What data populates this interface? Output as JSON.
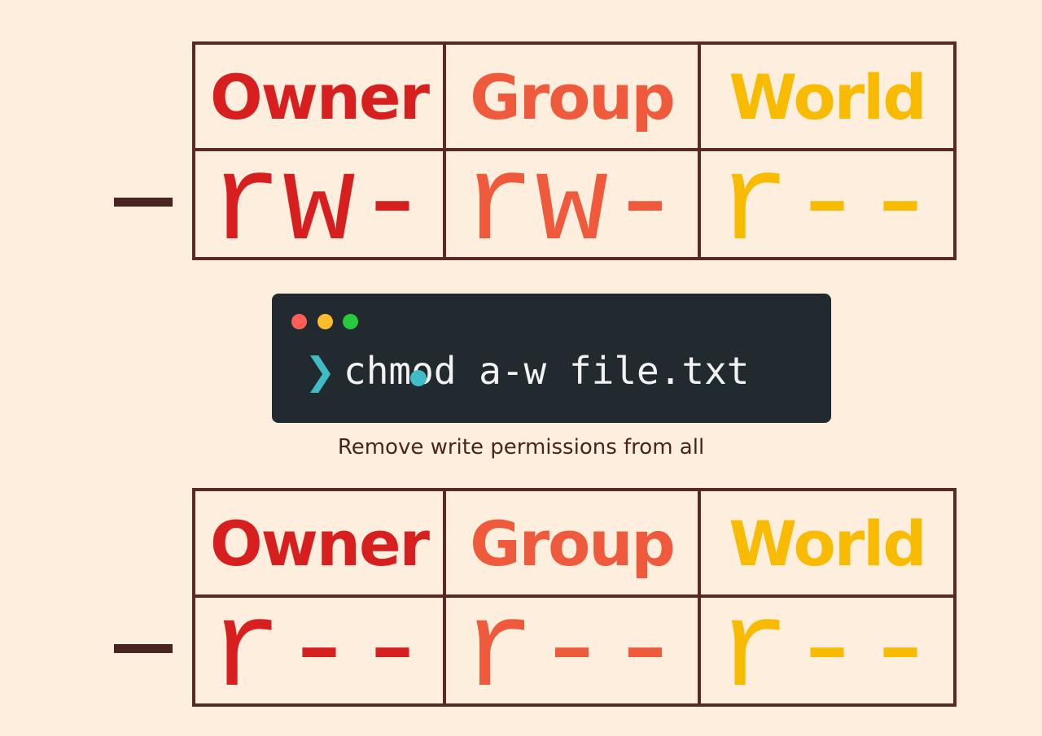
{
  "top_table": {
    "file_type": "-",
    "headers": [
      "Owner",
      "Group",
      "World"
    ],
    "permissions": [
      "rw-",
      "rw-",
      "r--"
    ]
  },
  "terminal": {
    "prompt_icon": "chevron-right-icon",
    "command": "chmod a-w file.txt"
  },
  "caption": "Remove write permissions from all",
  "bottom_table": {
    "file_type": "-",
    "headers": [
      "Owner",
      "Group",
      "World"
    ],
    "permissions": [
      "r--",
      "r--",
      "r--"
    ]
  },
  "colors": {
    "background": "#fdeedd",
    "border": "#5a2a22",
    "owner": "#d81f1f",
    "group": "#ef5a3c",
    "world": "#f8bb00",
    "terminal_bg": "#212a2e"
  }
}
